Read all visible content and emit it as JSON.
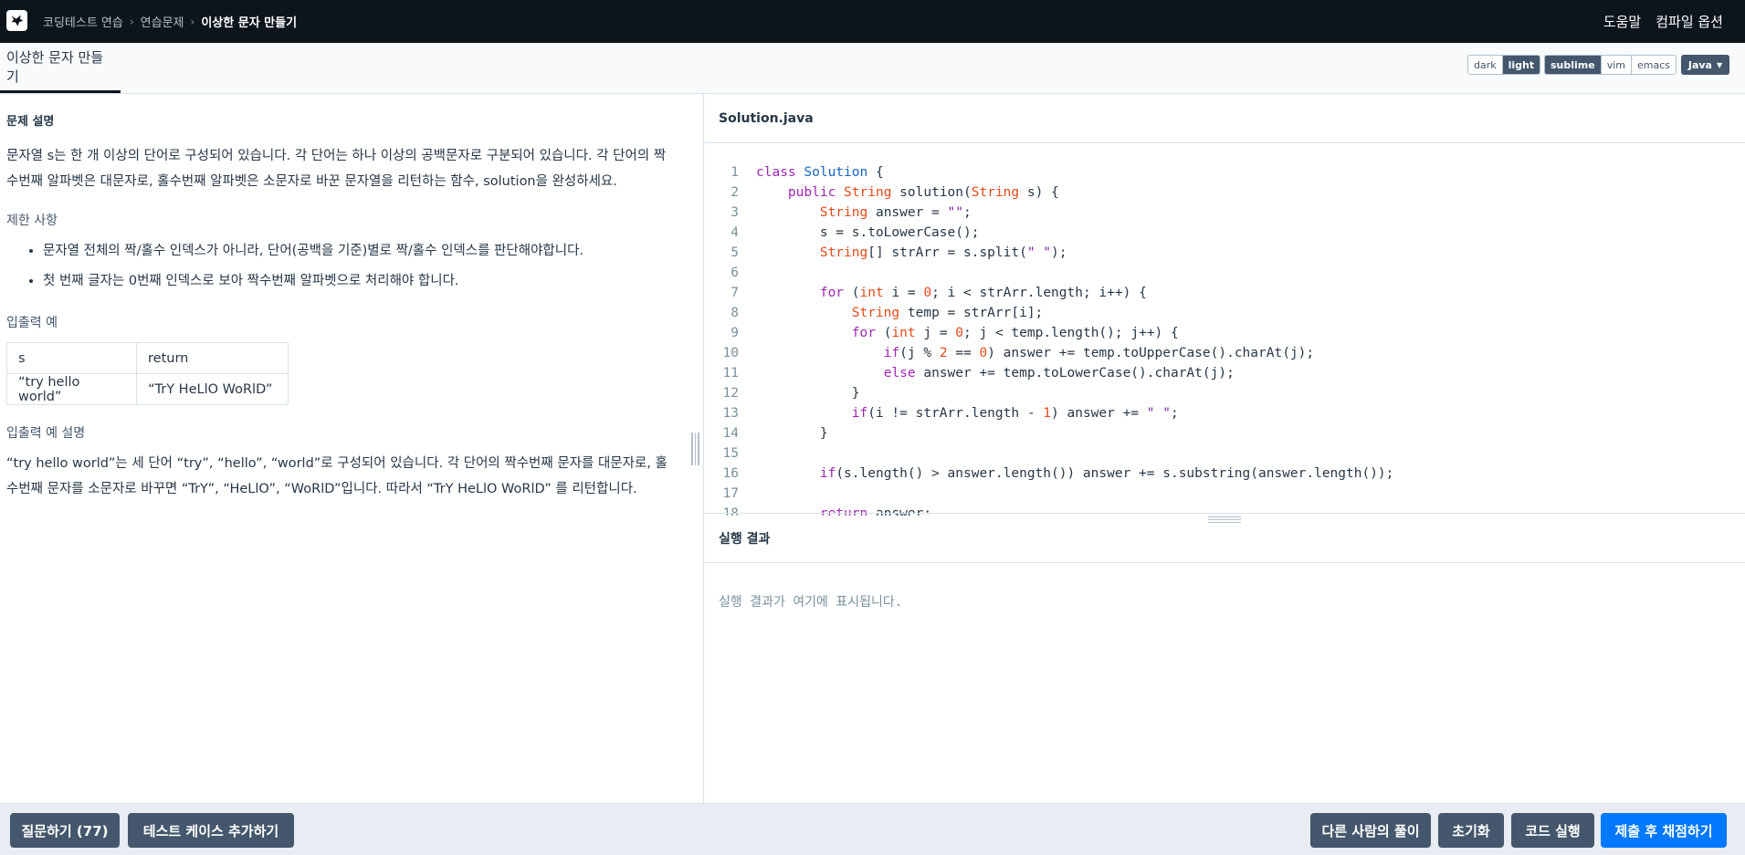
{
  "topbar": {
    "breadcrumbs": [
      "코딩테스트 연습",
      "연습문제",
      "이상한 문자 만들기"
    ],
    "help": "도움말",
    "compile_options": "컴파일 옵션"
  },
  "tabbar": {
    "title": "이상한 문자 만들기",
    "theme": {
      "dark": "dark",
      "light": "light",
      "selected": "light"
    },
    "keymap": {
      "sublime": "sublime",
      "vim": "vim",
      "emacs": "emacs",
      "selected": "sublime"
    },
    "language": "Java"
  },
  "problem": {
    "section_title": "문제 설명",
    "description": "문자열 s는 한 개 이상의 단어로 구성되어 있습니다. 각 단어는 하나 이상의 공백문자로 구분되어 있습니다. 각 단어의 짝수번째 알파벳은 대문자로, 홀수번째 알파벳은 소문자로 바꾼 문자열을 리턴하는 함수, solution을 완성하세요.",
    "constraints_title": "제한 사항",
    "constraints": [
      "문자열 전체의 짝/홀수 인덱스가 아니라, 단어(공백을 기준)별로 짝/홀수 인덱스를 판단해야합니다.",
      "첫 번째 글자는 0번째 인덱스로 보아 짝수번째 알파벳으로 처리해야 합니다."
    ],
    "example_title": "입출력 예",
    "example_table": {
      "headers": [
        "s",
        "return"
      ],
      "rows": [
        [
          "“try hello world”",
          "“TrY HeLlO WoRlD”"
        ]
      ]
    },
    "explanation_title": "입출력 예 설명",
    "explanation": "“try hello world”는 세 단어 “try”, “hello”, “world”로 구성되어 있습니다. 각 단어의 짝수번째 문자를 대문자로, 홀수번째 문자를 소문자로 바꾸면 “TrY”, “HeLlO”, “WoRlD”입니다. 따라서 “TrY HeLlO WoRlD” 를 리턴합니다."
  },
  "editor": {
    "filename": "Solution.java",
    "lines": [
      "class Solution {",
      "    public String solution(String s) {",
      "        String answer = \"\";",
      "        s = s.toLowerCase();",
      "        String[] strArr = s.split(\" \");",
      "",
      "        for (int i = 0; i < strArr.length; i++) {",
      "            String temp = strArr[i];",
      "            for (int j = 0; j < temp.length(); j++) {",
      "                if(j % 2 == 0) answer += temp.toUpperCase().charAt(j);",
      "                else answer += temp.toLowerCase().charAt(j);",
      "            }",
      "            if(i != strArr.length - 1) answer += \" \";",
      "        }",
      "",
      "        if(s.length() > answer.length()) answer += s.substring(answer.length());",
      "",
      "        return answer;"
    ]
  },
  "result": {
    "title": "실행 결과",
    "placeholder": "실행 결과가 여기에 표시됩니다."
  },
  "footer": {
    "ask": "질문하기 (77)",
    "add_testcase": "테스트 케이스 추가하기",
    "others_solutions": "다른 사람의 풀이",
    "reset": "초기화",
    "run": "코드 실행",
    "submit": "제출 후 채점하기"
  }
}
